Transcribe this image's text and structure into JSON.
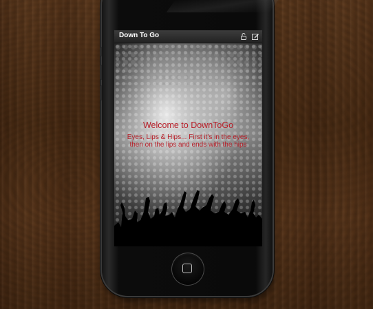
{
  "app": {
    "title": "Down To Go"
  },
  "titlebar": {
    "icons": [
      "lock-icon",
      "edit-icon"
    ]
  },
  "hero": {
    "heading": "Welcome to DownToGo",
    "subtitle_line1": "Eyes, Lips & Hips... First it's in the eyes,",
    "subtitle_line2": "then on the lips and ends with the hips"
  },
  "colors": {
    "accent": "#b8202a",
    "titlebar_text": "#ffffff",
    "titlebar_bg": "#2b2b2b"
  }
}
